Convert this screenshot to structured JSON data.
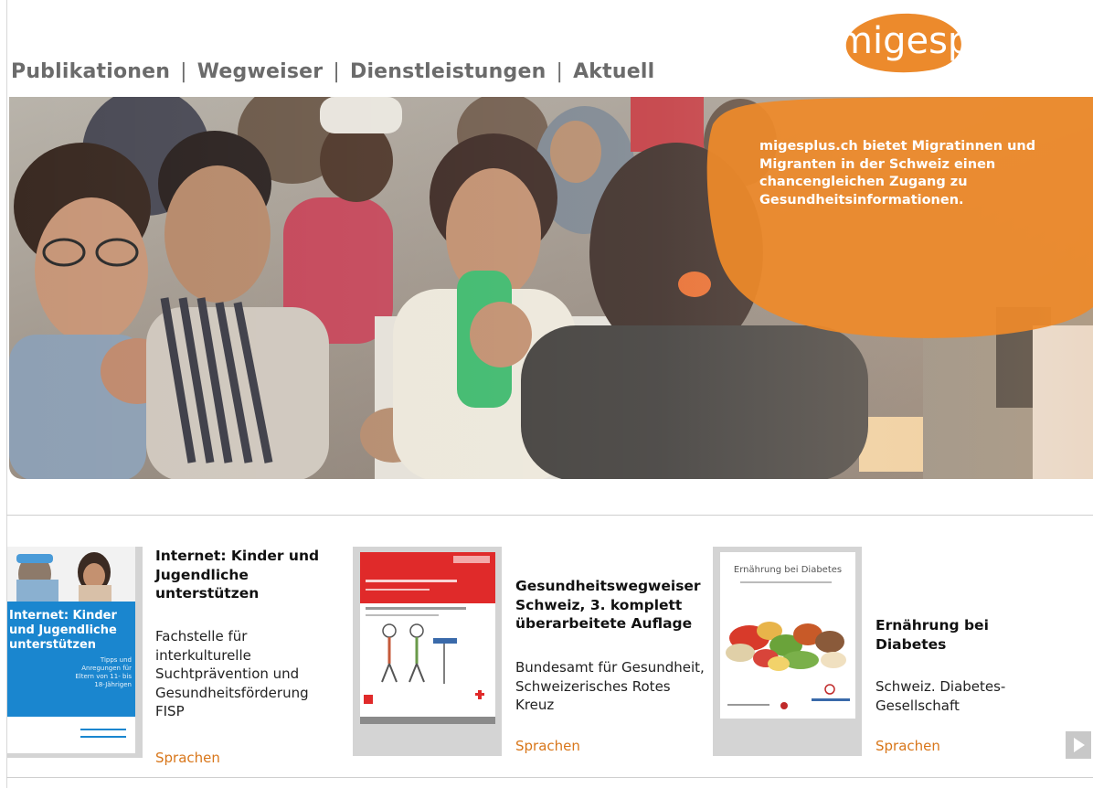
{
  "logo": {
    "text": "migesplus"
  },
  "nav": {
    "items": [
      "Publikationen",
      "Wegweiser",
      "Dienstleistungen",
      "Aktuell"
    ],
    "separator": "|"
  },
  "hero": {
    "text": "migesplus.ch bietet Migratinnen und Migranten in der Schweiz einen chancengleichen Zugang zu Gesundheitsinformationen."
  },
  "publications": [
    {
      "cover_title": "Internet: Kinder und Jugendliche unterstützen",
      "cover_subtitle": "Tipps und Anregungen für Eltern von 11- bis 18-Jährigen",
      "title": "Internet: Kinder und Jugendliche unterstützen",
      "publisher": "Fachstelle für interkulturelle Suchtprävention und Gesundheitsförderung FISP",
      "link": "Sprachen"
    },
    {
      "title": "Gesundheitswegweiser Schweiz, 3. komplett überarbeitete Auflage",
      "publisher": "Bundesamt für Gesundheit, Schweizerisches Rotes Kreuz",
      "link": "Sprachen"
    },
    {
      "cover_title": "Ernährung bei Diabetes",
      "title": "Ernährung bei Diabetes",
      "publisher": "Schweiz. Diabetes-Gesellschaft",
      "link": "Sprachen"
    }
  ],
  "colors": {
    "brand_orange": "#e8781e",
    "nav_gray": "#6b6b6b",
    "link_orange": "#d8761a"
  }
}
